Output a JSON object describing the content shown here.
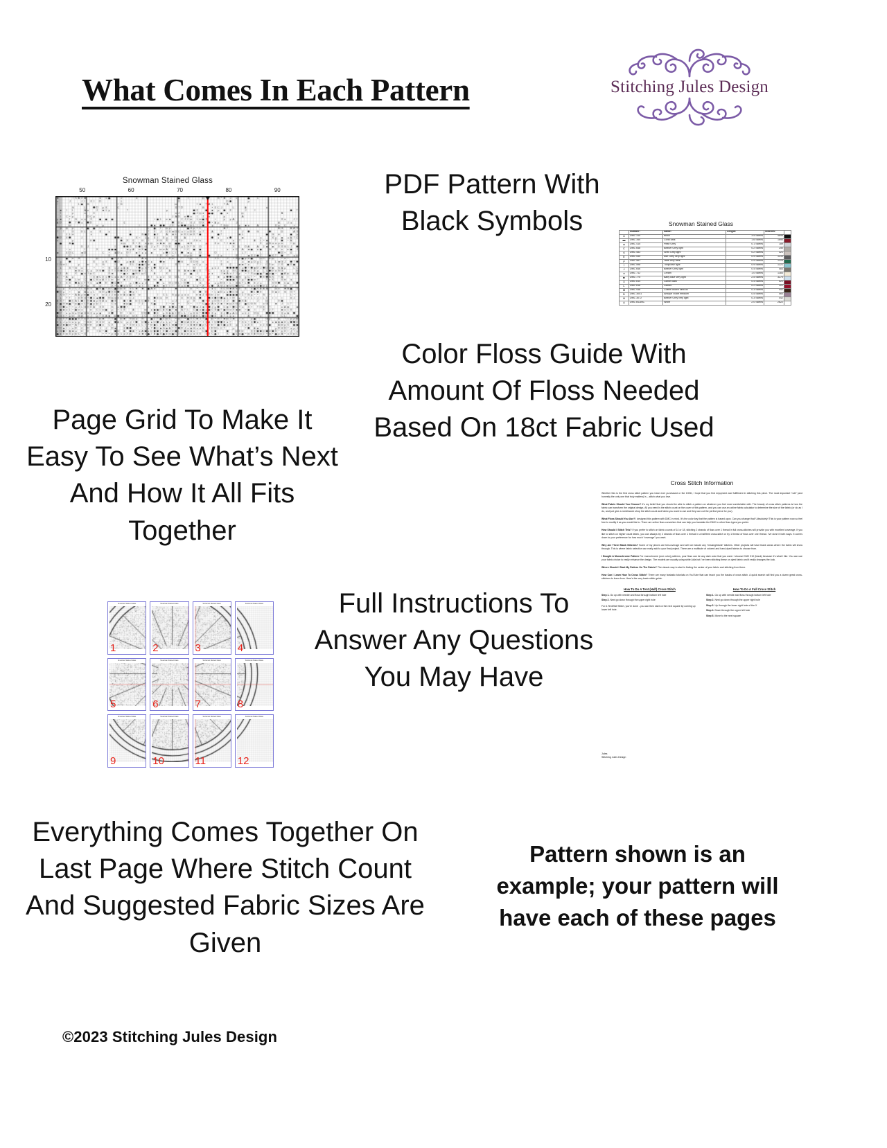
{
  "header": {
    "title": "What Comes In Each Pattern",
    "logo_wordmark": "Stitching Jules Design",
    "logo_color": "#5b2b55",
    "flourish_color": "#7b5aa6"
  },
  "copy": {
    "pdf_pattern": "PDF Pattern With Black Symbols",
    "page_grid": "Page Grid To Make It Easy To See What’s Next And How It All Fits Together",
    "floss_guide": "Color Floss Guide With Amount Of Floss Needed Based On 18ct Fabric Used",
    "instructions": "Full Instructions To Answer Any Questions You May Have",
    "everything": "Everything Comes Together On Last Page Where Stitch Count And Suggested Fabric Sizes Are Given",
    "disclaimer": "Pattern shown is an example; your pattern will have each of these pages",
    "copyright": "©2023 Stitching Jules Design"
  },
  "chart": {
    "title": "Snowman Stained Glass",
    "column_labels": [
      "50",
      "60",
      "70",
      "80",
      "90"
    ],
    "row_labels": [
      "10",
      "20"
    ],
    "center_line_color": "#ff0000",
    "grid_color": "#111111"
  },
  "floss": {
    "title": "Snowman Stained Glass",
    "columns": [
      "",
      "Number:",
      "Name:",
      "Length:",
      "Stitches:",
      ""
    ],
    "rows": [
      {
        "symbol": "●",
        "number": "DMC   310",
        "name": "Black",
        "length": "3.5 Skeins",
        "stitches": "4896",
        "color": "#111111"
      },
      {
        "symbol": "▬",
        "number": "DMC   340",
        "name": "Coral dark",
        "length": "1.6 Skeins",
        "stitches": "1890",
        "color": "#8a1b2a"
      },
      {
        "symbol": "▲",
        "number": "DMC   415",
        "name": "Pearl Grey",
        "length": "0.1 Skeins",
        "stitches": "189",
        "color": "#cfd3d6"
      },
      {
        "symbol": "C",
        "number": "DMC   648",
        "name": "Beaver Grey light",
        "length": "0.2 Skeins",
        "stitches": "250",
        "color": "#b2aea8"
      },
      {
        "symbol": "6",
        "number": "DMC   453",
        "name": "Shell Grey light",
        "length": "0.2 Skeins",
        "stitches": "321",
        "color": "#cbc2bd"
      },
      {
        "symbol": "E",
        "number": "DMC   535",
        "name": "Ash Grey very light",
        "length": "0.9 Skeins",
        "stitches": "1210",
        "color": "#5a5a5c"
      },
      {
        "symbol": "ρ",
        "number": "DMC   561",
        "name": "Jade very dark",
        "length": "0.9 Skeins",
        "stitches": "1220",
        "color": "#1f6b4e"
      },
      {
        "symbol": "†",
        "number": "DMC   598",
        "name": "Turquoise light",
        "length": "0.9 Skeins",
        "stitches": "1221",
        "color": "#87c4ce"
      },
      {
        "symbol": "J",
        "number": "DMC   646",
        "name": "Beaver Grey light",
        "length": "0.4 Skeins",
        "stitches": "483",
        "color": "#7b776f"
      },
      {
        "symbol": "♦",
        "number": "DMC   712",
        "name": "Cream",
        "length": "1.0 Skeins",
        "stitches": "1383",
        "color": "#f2e9d6"
      },
      {
        "symbol": "■",
        "number": "DMC   775",
        "name": "Baby Blue very light",
        "length": "2.5 Skeins",
        "stitches": "3270",
        "color": "#cfe0ee"
      },
      {
        "symbol": "X",
        "number": "DMC   814",
        "name": "Garnet dark",
        "length": "0.4 Skeins",
        "stitches": "521",
        "color": "#7a0e22"
      },
      {
        "symbol": "L",
        "number": "DMC   816",
        "name": "Garnet",
        "length": "0.2 Skeins",
        "stitches": "301",
        "color": "#97102a"
      },
      {
        "symbol": "☒",
        "number": "DMC   938",
        "name": "Coffee Brown ultra dk",
        "length": "0.3 Skeins",
        "stitches": "441",
        "color": "#3a2317"
      },
      {
        "symbol": "D",
        "number": "DMC   3041",
        "name": "Antique Violet medium",
        "length": "0.5 Skeins",
        "stitches": "560",
        "color": "#9a8195"
      },
      {
        "symbol": "▼",
        "number": "DMC   3072",
        "name": "Beaver Grey very light",
        "length": "0.3 Skeins",
        "stitches": "442",
        "color": "#dcdcd6"
      },
      {
        "symbol": "A",
        "number": "DMC   BLANC",
        "name": "White",
        "length": "2.0 Skeins",
        "stitches": "2622",
        "color": "#ffffff"
      }
    ]
  },
  "page_grid": {
    "thumb_title": "Snowman Stained Glass",
    "border_color": "#7b79d8",
    "number_color": "#e8241c",
    "pages": [
      "1",
      "2",
      "3",
      "4",
      "5",
      "6",
      "7",
      "8",
      "9",
      "10",
      "11",
      "12"
    ]
  },
  "instructions": {
    "title": "Cross Stitch Information",
    "paragraphs": [
      {
        "lead": "",
        "text": "Whether this is the first cross stitch pattern you have ever purchased or the 100th, I hope that you find enjoyment and fulfillment in stitching this piece. The most important “rule” (and honestly the only one that truly matters) is – stitch what you love."
      },
      {
        "lead": "What Fabric Should You Choose?",
        "text": "It’s my belief that you should be able to stitch a pattern on whatever you feel most comfortable with. The beauty of cross stitch patterns is how the fabric can transform the original design. All you need is the stitch count on the cover of this pattern, and you can use an online fabric calculator to determine the size of the fabric (or do as I do, and just give a needlework shop the stitch count and fabric you want to use and they can cut the perfect piece for you)."
      },
      {
        "lead": "What Floss Should You Use?",
        "text": "I designed this pattern with DMC in mind. It’s the color key that the pattern is based upon. Can you change that? Absolutely! This is your pattern now so feel free to modify it as you would like to. There are online floss converters that can help you translate the DMC to other floss types you prefer."
      },
      {
        "lead": "How Should I Stitch This?",
        "text": "If you prefer to stitch on fabric counts of 14 or 18, stitching 2 strands of floss over 1 thread in full cross-stitches will provide you with excellent coverage. If you like to stitch on higher count fabric, you can always try 2 strands of floss over 1 thread in a half/tent cross-stitch or try 1 thread of floss over one thread. I’ve done it both ways. It comes down to your preference for how much “coverage” you want."
      },
      {
        "lead": "Why Are There Blank Stitches?",
        "text": "Some of my pieces are full-coverage and will not include any “missing/blank” stitches. Other projects will have blank areas where the fabric will show through. This is where fabric selection can really add to your final project. There are a multitude of colored and hand-dyed fabrics to choose from."
      },
      {
        "lead": "I Bought A Monochrome Pattern",
        "text": "For monochrome (one color) patterns, your floss can be any dark color that you want. I choose DMC 310 (black) because it’s what I like. You can use your fabric choice to really enhance the design. The models are usually using white Aida but I’ve been stitching these on dyed fabric and it really changes the look."
      },
      {
        "lead": "Where Should I Start My Pattern On The Fabric?",
        "text": "The classic way to start is finding the center of your fabric and stitching from there."
      },
      {
        "lead": "How Can I Learn How To Cross Stitch?",
        "text": "There are many fantastic tutorials on YouTube that can teach you the basics of cross stitch. A quick search will find you a dozen great cross-stitchers to learn from. Here’s the very basic stitch guide."
      }
    ],
    "tent_stitch": {
      "heading": "How To Do A Tent (Half) Cross Stitch",
      "steps": [
        {
          "label": "Step 1.",
          "text": "Go up with needle and floss through bottom left hole"
        },
        {
          "label": "Step 2.",
          "text": "Next go down through the upper right hole"
        }
      ],
      "note": "For A Tent/Half Stitch, you’re done - you can then start on the next square by coming up lower left hole."
    },
    "full_stitch": {
      "heading": "How To Do A Full Cross Stitch",
      "steps": [
        {
          "label": "Step 1.",
          "text": "Go up with needle and floss through bottom left hole"
        },
        {
          "label": "Step 2.",
          "text": "Next go down through the upper right hole"
        },
        {
          "label": "Step 3.",
          "text": "Up through the lower right hole of the X"
        },
        {
          "label": "Step 4.",
          "text": "Down through the upper left hole"
        },
        {
          "label": "Step 5.",
          "text": "Move to the next square"
        }
      ]
    },
    "signature": {
      "name": "Jules",
      "company": "Stitching Jules Design"
    }
  }
}
